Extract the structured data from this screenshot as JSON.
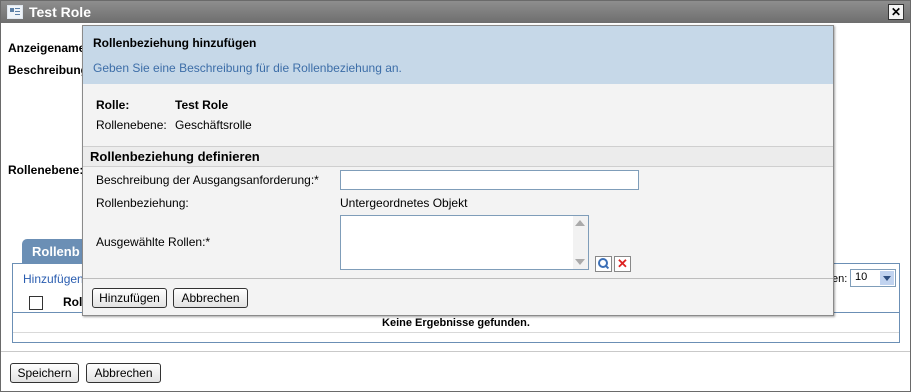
{
  "window": {
    "title": "Test Role",
    "icon": "role-icon",
    "close_icon": "close-icon",
    "close_glyph": "✕"
  },
  "background_form": {
    "display_name_label": "Anzeigename",
    "description_label": "Beschreibung",
    "role_level_label": "Rollenebene:",
    "tab_label": "Rollenb",
    "add_link": "Hinzufügen",
    "page_size_label": "en:",
    "page_size_value": "10",
    "column_header": "Rol",
    "no_results": "Keine Ergebnisse gefunden.",
    "save_button": "Speichern",
    "cancel_button": "Abbrechen"
  },
  "dialog": {
    "title": "Rollenbeziehung hinzufügen",
    "subtitle": "Geben Sie eine Beschreibung für die Rollenbeziehung an.",
    "role_label": "Rolle:",
    "role_value": "Test Role",
    "role_level_label": "Rollenebene:",
    "role_level_value": "Geschäftsrolle",
    "section_title": "Rollenbeziehung definieren",
    "request_description_label": "Beschreibung der Ausgangsanforderung:*",
    "request_description_value": "",
    "relationship_label": "Rollenbeziehung:",
    "relationship_value": "Untergeordnetes Objekt",
    "selected_roles_label": "Ausgewählte Rollen:*",
    "selected_roles_value": "",
    "clear_glyph": "✕",
    "add_button": "Hinzufügen",
    "cancel_button": "Abbrechen"
  },
  "colors": {
    "title_bar": "#7a7a7a",
    "dialog_header": "#c6d8e8",
    "link": "#2a5db0",
    "tab": "#6b8fb5"
  }
}
